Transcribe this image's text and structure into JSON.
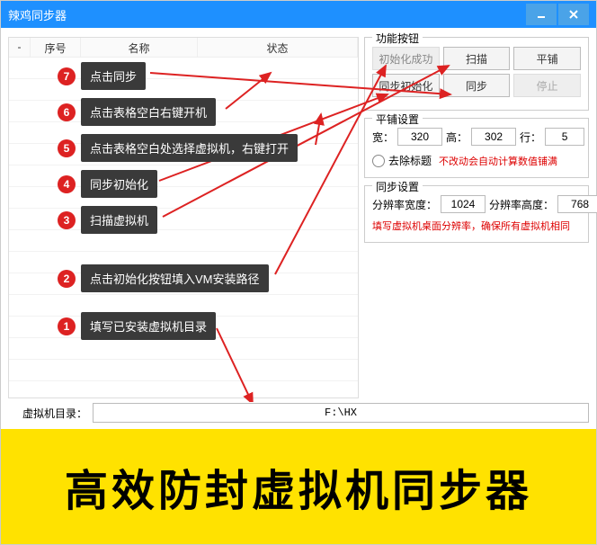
{
  "window": {
    "title": "辣鸡同步器"
  },
  "table": {
    "columns": {
      "dash": "-",
      "seq": "序号",
      "name": "名称",
      "status": "状态"
    }
  },
  "func_buttons": {
    "title": "功能按钮",
    "init": "初始化成功",
    "scan": "扫描",
    "tile": "平铺",
    "sync_init": "同步初始化",
    "sync": "同步",
    "stop": "停止"
  },
  "tile_settings": {
    "title": "平铺设置",
    "width_label": "宽：",
    "width": "320",
    "height_label": "高：",
    "height": "302",
    "row_label": "行：",
    "rows": "5",
    "strip_title_label": "去除标题",
    "tip": "不改动会自动计算数值铺满"
  },
  "sync_settings": {
    "title": "同步设置",
    "res_w_label": "分辨率宽度：",
    "res_w": "1024",
    "res_h_label": "分辨率高度：",
    "res_h": "768",
    "tip": "填写虚拟机桌面分辨率，确保所有虚拟机相同"
  },
  "path": {
    "label": "虚拟机目录：",
    "value": "F:\\HX"
  },
  "callouts": {
    "c1": "填写已安装虚拟机目录",
    "c2": "点击初始化按钮填入VM安装路径",
    "c3": "扫描虚拟机",
    "c4": "同步初始化",
    "c5": "点击表格空白处选择虚拟机，右键打开",
    "c6": "点击表格空白右键开机",
    "c7": "点击同步"
  },
  "banner": {
    "text": "高效防封虚拟机同步器"
  }
}
